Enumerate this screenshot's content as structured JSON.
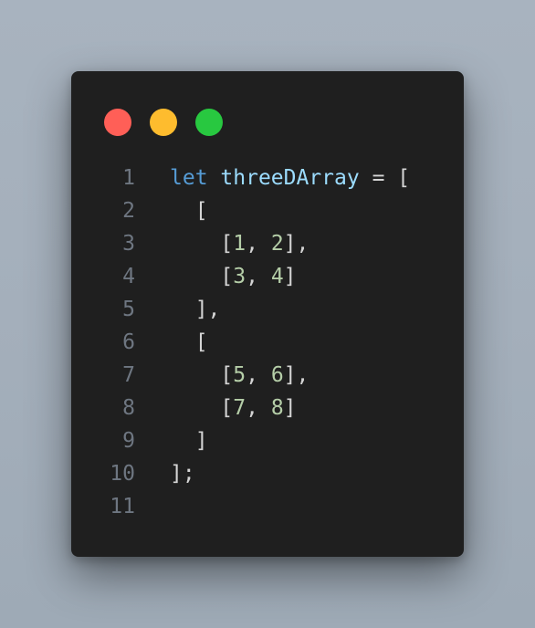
{
  "window": {
    "controls": [
      {
        "name": "close",
        "color": "#ff5f57"
      },
      {
        "name": "minimize",
        "color": "#febc2e"
      },
      {
        "name": "maximize",
        "color": "#28c840"
      }
    ]
  },
  "code": {
    "language": "javascript",
    "lines": [
      {
        "number": "1",
        "tokens": [
          {
            "type": "kw",
            "text": "let"
          },
          {
            "type": "punc",
            "text": " "
          },
          {
            "type": "var",
            "text": "threeDArray"
          },
          {
            "type": "punc",
            "text": " = ["
          }
        ]
      },
      {
        "number": "2",
        "tokens": [
          {
            "type": "punc",
            "text": "  ["
          }
        ]
      },
      {
        "number": "3",
        "tokens": [
          {
            "type": "punc",
            "text": "    ["
          },
          {
            "type": "num",
            "text": "1"
          },
          {
            "type": "punc",
            "text": ", "
          },
          {
            "type": "num",
            "text": "2"
          },
          {
            "type": "punc",
            "text": "],"
          }
        ]
      },
      {
        "number": "4",
        "tokens": [
          {
            "type": "punc",
            "text": "    ["
          },
          {
            "type": "num",
            "text": "3"
          },
          {
            "type": "punc",
            "text": ", "
          },
          {
            "type": "num",
            "text": "4"
          },
          {
            "type": "punc",
            "text": "]"
          }
        ]
      },
      {
        "number": "5",
        "tokens": [
          {
            "type": "punc",
            "text": "  ],"
          }
        ]
      },
      {
        "number": "6",
        "tokens": [
          {
            "type": "punc",
            "text": "  ["
          }
        ]
      },
      {
        "number": "7",
        "tokens": [
          {
            "type": "punc",
            "text": "    ["
          },
          {
            "type": "num",
            "text": "5"
          },
          {
            "type": "punc",
            "text": ", "
          },
          {
            "type": "num",
            "text": "6"
          },
          {
            "type": "punc",
            "text": "],"
          }
        ]
      },
      {
        "number": "8",
        "tokens": [
          {
            "type": "punc",
            "text": "    ["
          },
          {
            "type": "num",
            "text": "7"
          },
          {
            "type": "punc",
            "text": ", "
          },
          {
            "type": "num",
            "text": "8"
          },
          {
            "type": "punc",
            "text": "]"
          }
        ]
      },
      {
        "number": "9",
        "tokens": [
          {
            "type": "punc",
            "text": "  ]"
          }
        ]
      },
      {
        "number": "10",
        "tokens": [
          {
            "type": "punc",
            "text": "];"
          }
        ]
      },
      {
        "number": "11",
        "tokens": []
      }
    ]
  }
}
